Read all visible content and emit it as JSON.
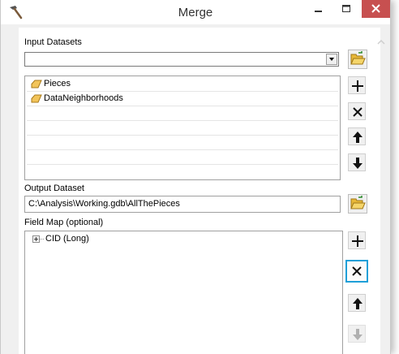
{
  "window": {
    "title": "Merge"
  },
  "input_datasets": {
    "label": "Input Datasets",
    "combo_value": "",
    "items": [
      {
        "label": "Pieces",
        "icon": "feature-class-icon"
      },
      {
        "label": "DataNeighborhoods",
        "icon": "feature-class-icon"
      }
    ]
  },
  "output_dataset": {
    "label": "Output Dataset",
    "value": "C:\\Analysis\\Working.gdb\\AllThePieces"
  },
  "field_map": {
    "label": "Field Map (optional)",
    "items": [
      {
        "label": "CID (Long)"
      }
    ]
  },
  "colors": {
    "selection_accent": "#1e9fd8",
    "close_button": "#c75050",
    "folder_icon": "#e8b838"
  }
}
